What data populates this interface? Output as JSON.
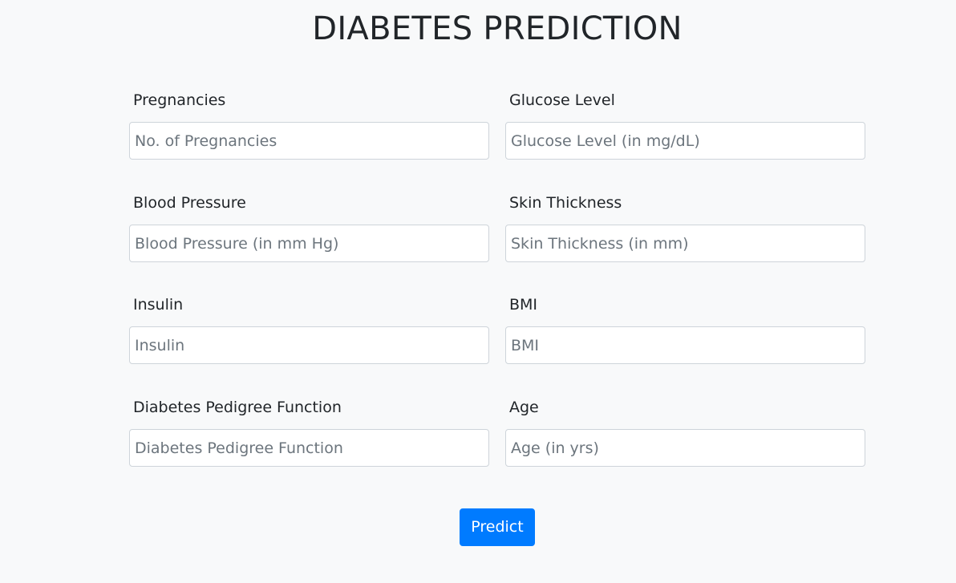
{
  "page": {
    "title": "DIABETES PREDICTION"
  },
  "form": {
    "rows": [
      {
        "left": {
          "label": "Pregnancies",
          "placeholder": "No. of Pregnancies",
          "value": ""
        },
        "right": {
          "label": "Glucose Level",
          "placeholder": "Glucose Level (in mg/dL)",
          "value": ""
        }
      },
      {
        "left": {
          "label": "Blood Pressure",
          "placeholder": "Blood Pressure (in mm Hg)",
          "value": ""
        },
        "right": {
          "label": "Skin Thickness",
          "placeholder": "Skin Thickness (in mm)",
          "value": ""
        }
      },
      {
        "left": {
          "label": "Insulin",
          "placeholder": "Insulin",
          "value": ""
        },
        "right": {
          "label": "BMI",
          "placeholder": "BMI",
          "value": ""
        }
      },
      {
        "left": {
          "label": "Diabetes Pedigree Function",
          "placeholder": "Diabetes Pedigree Function",
          "value": ""
        },
        "right": {
          "label": "Age",
          "placeholder": "Age (in yrs)",
          "value": ""
        }
      }
    ],
    "submit_label": "Predict"
  },
  "colors": {
    "background": "#f8f9fa",
    "primary": "#007bff",
    "input_border": "#ced4da",
    "text": "#212529",
    "placeholder": "#6c757d"
  }
}
